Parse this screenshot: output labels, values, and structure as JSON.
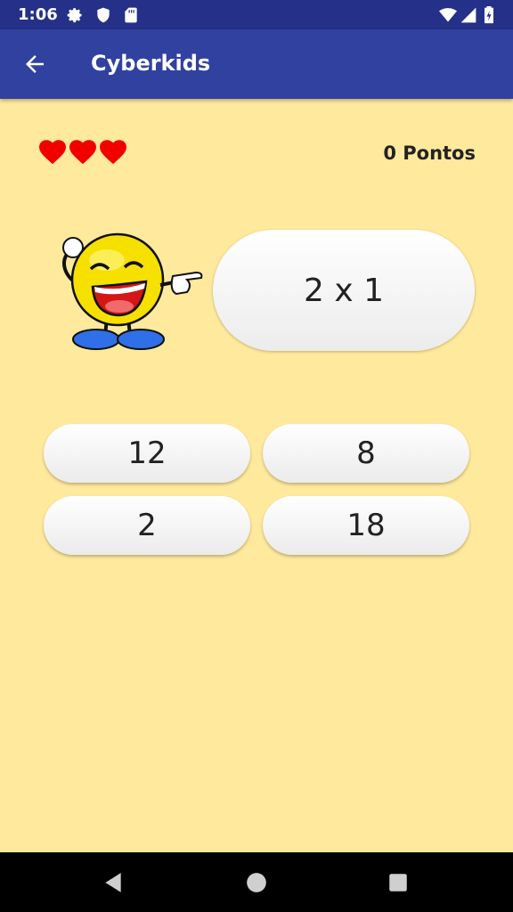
{
  "status_bar": {
    "time": "1:06",
    "icons": [
      "gear-icon",
      "shield-icon",
      "sd-card-icon",
      "wifi-icon",
      "signal-icon",
      "battery-icon"
    ]
  },
  "app_bar": {
    "title": "Cyberkids",
    "back_icon": "arrow-left-icon"
  },
  "game": {
    "lives": 3,
    "points_label": "0 Pontos",
    "question": "2 x 1",
    "answers": [
      "12",
      "8",
      "2",
      "18"
    ]
  },
  "nav_bar": {
    "icons": [
      "back-triangle-icon",
      "home-circle-icon",
      "recents-square-icon"
    ]
  },
  "colors": {
    "status_bar": "#253088",
    "app_bar": "#3041A0",
    "background": "#FFE99C",
    "heart": "#F20000"
  }
}
